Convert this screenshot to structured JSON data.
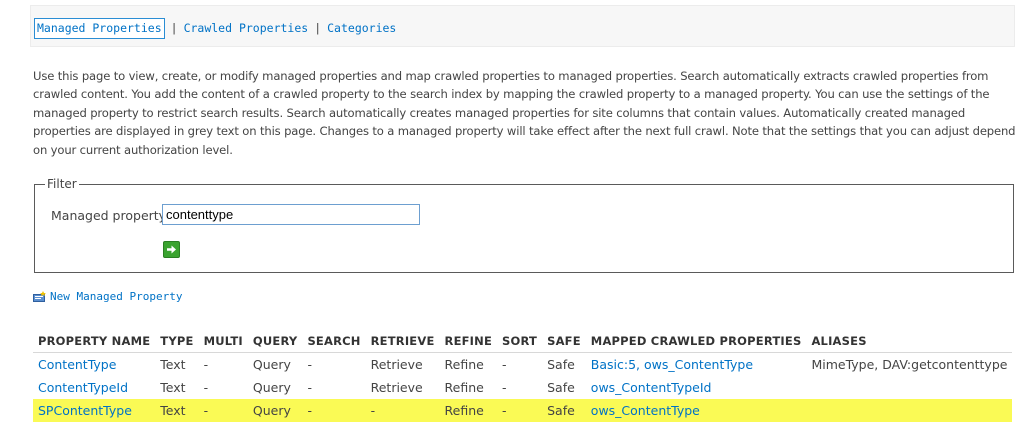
{
  "nav": {
    "items": [
      "Managed Properties",
      "Crawled Properties",
      "Categories"
    ],
    "separator": "|"
  },
  "description": "Use this page to view, create, or modify managed properties and map crawled properties to managed properties. Search automatically extracts crawled properties from crawled content. You add the content of a crawled property to the search index by mapping the crawled property to a managed property. You can use the settings of the managed property to restrict search results. Search automatically creates managed properties for site columns that contain values. Automatically created managed properties are displayed in grey text on this page. Changes to a managed property will take effect after the next full crawl. Note that the settings that you can adjust depend on your current authorization level.",
  "filter": {
    "legend": "Filter",
    "label": "Managed property",
    "value": "contenttype",
    "go_icon": "arrow-right-icon"
  },
  "new_property": {
    "label": "New Managed Property",
    "icon": "new-item-icon"
  },
  "table": {
    "headers": [
      "PROPERTY NAME",
      "TYPE",
      "MULTI",
      "QUERY",
      "SEARCH",
      "RETRIEVE",
      "REFINE",
      "SORT",
      "SAFE",
      "MAPPED CRAWLED PROPERTIES",
      "ALIASES"
    ],
    "rows": [
      {
        "name": "ContentType",
        "type": "Text",
        "multi": "-",
        "query": "Query",
        "search": "-",
        "retrieve": "Retrieve",
        "refine": "Refine",
        "sort": "-",
        "safe": "Safe",
        "mapped": "Basic:5, ows_ContentType",
        "aliases": "MimeType, DAV:getcontenttype"
      },
      {
        "name": "ContentTypeId",
        "type": "Text",
        "multi": "-",
        "query": "Query",
        "search": "-",
        "retrieve": "Retrieve",
        "refine": "Refine",
        "sort": "-",
        "safe": "Safe",
        "mapped": "ows_ContentTypeId",
        "aliases": ""
      },
      {
        "name": "SPContentType",
        "type": "Text",
        "multi": "-",
        "query": "Query",
        "search": "-",
        "retrieve": "-",
        "refine": "Refine",
        "sort": "-",
        "safe": "Safe",
        "mapped": "ows_ContentType",
        "aliases": ""
      }
    ],
    "highlight_color": "#fafa55"
  },
  "colors": {
    "link": "#0072c6",
    "text": "#444444"
  }
}
